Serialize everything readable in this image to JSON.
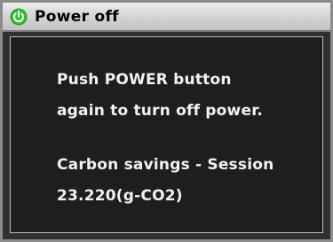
{
  "dialog": {
    "title": "Power off",
    "icon": "power-icon",
    "message_line1": "Push POWER button",
    "message_line2": "again to turn off power.",
    "carbon_label": "Carbon savings - Session",
    "carbon_value": "23.220(g-CO2)"
  },
  "colors": {
    "icon_green": "#1fa81f",
    "frame_background": "#303030",
    "panel_background": "#1e1e1e",
    "text": "#f2f2f2"
  }
}
